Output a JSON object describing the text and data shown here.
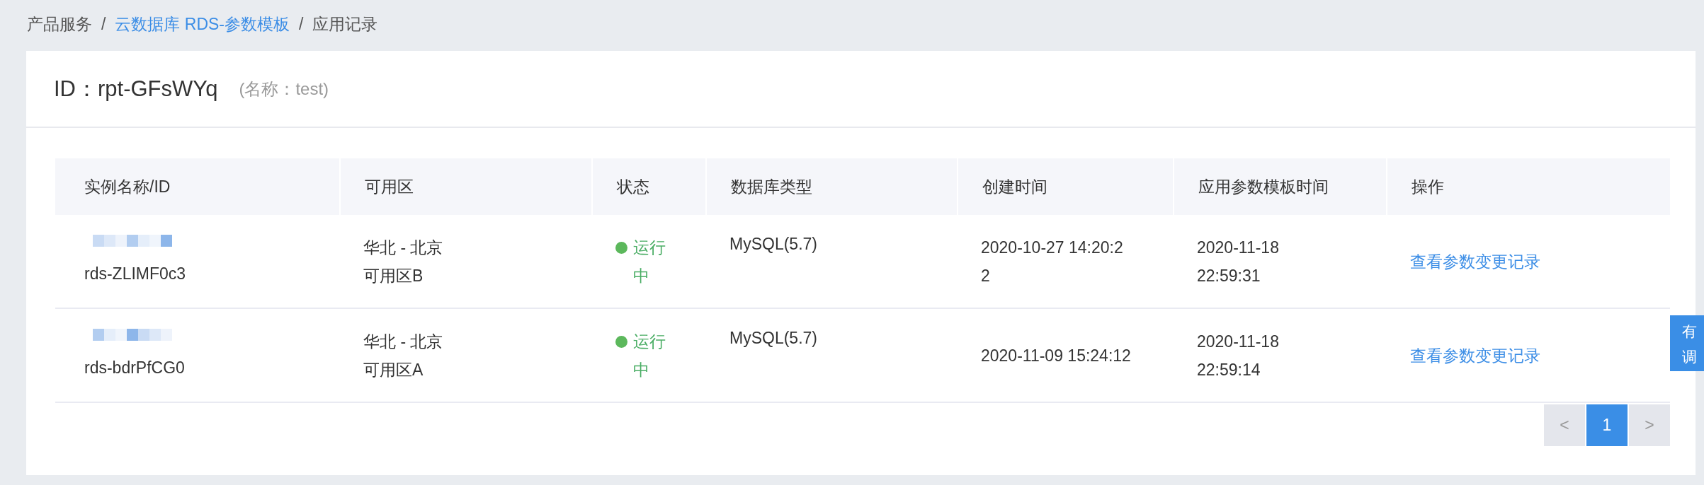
{
  "breadcrumb": [
    {
      "kind": "text",
      "label": "产品服务"
    },
    {
      "kind": "separator",
      "label": "/"
    },
    {
      "kind": "link",
      "label": "云数据库 RDS-参数模板"
    },
    {
      "kind": "separator",
      "label": "/"
    },
    {
      "kind": "current",
      "label": "应用记录"
    }
  ],
  "header": {
    "title": "ID：rpt-GFsWYq",
    "note": "(名称：test)"
  },
  "table": {
    "columns": [
      "实例名称/ID",
      "可用区",
      "状态",
      "数据库类型",
      "创建时间",
      "应用参数模板时间",
      "操作"
    ],
    "rows": [
      {
        "instance_id": "rds-ZLIMF0c3",
        "region": "华北 - 北京",
        "zone": "可用区B",
        "status": "运行中",
        "db_type": "MySQL(5.7)",
        "created": "2020-10-27 14:20:2\n2",
        "applied": "2020-11-18 22:59:31",
        "action": "查看参数变更记录"
      },
      {
        "instance_id": "rds-bdrPfCG0",
        "region": "华北 - 北京",
        "zone": "可用区A",
        "status": "运行中",
        "db_type": "MySQL(5.7)",
        "created": "2020-11-09 15:24:12",
        "applied": "2020-11-18 22:59:14",
        "action": "查看参数变更记录"
      }
    ]
  },
  "pagination": {
    "prev": {
      "label": "<",
      "disabled": true
    },
    "pages": [
      {
        "label": "1",
        "selected": true
      }
    ],
    "next": {
      "label": ">",
      "disabled": true
    }
  },
  "feedback_tab": {
    "lines": [
      "有",
      "调"
    ]
  }
}
